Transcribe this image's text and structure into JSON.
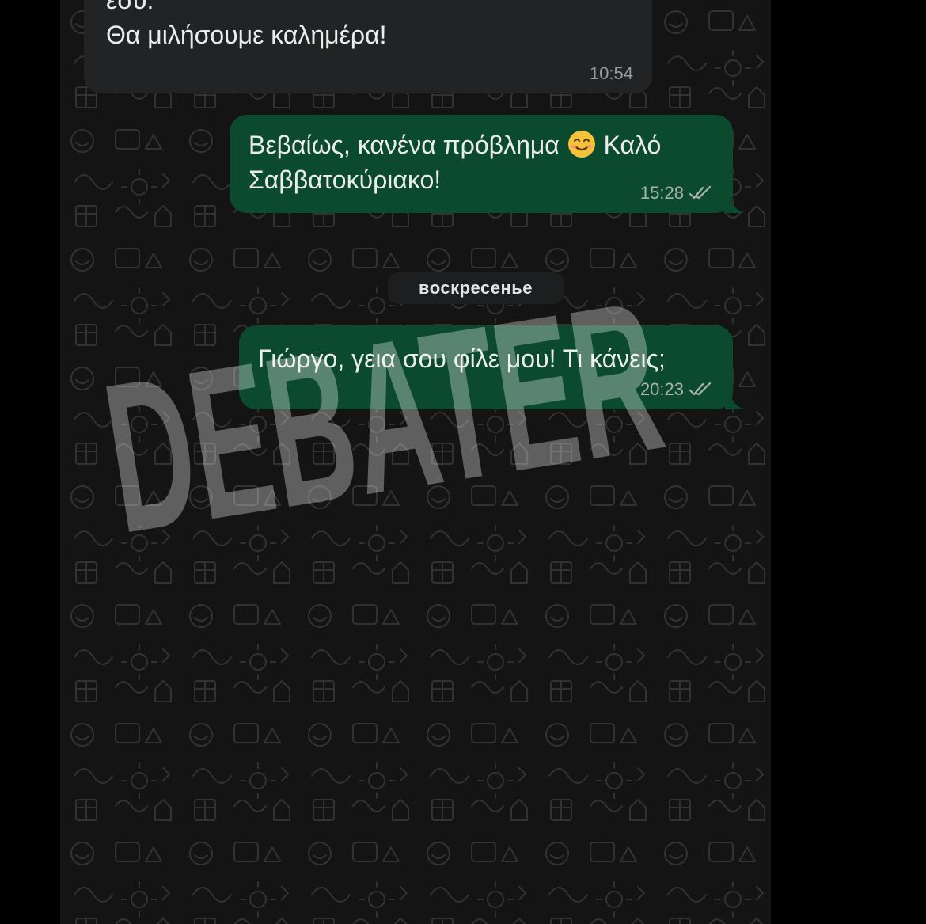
{
  "messages": [
    {
      "direction": "incoming",
      "lines": [
        "εσύ.",
        "Θα μιλήσουμε καλημέρα!"
      ],
      "time": "10:54"
    },
    {
      "direction": "outgoing",
      "line1_before_emoji": "Βεβαίως, κανένα πρόβλημα ",
      "line1_after_emoji": " Καλό",
      "line2": "Σαββατοκύριακο!",
      "emoji": "smiling-face-emoji",
      "time": "15:28",
      "status": "read"
    },
    {
      "direction": "outgoing",
      "lines": [
        "Γιώργο, γεια σου φίλε μου! Τι κάνεις;"
      ],
      "time": "20:23",
      "status": "read"
    }
  ],
  "date_separator": "воскресенье",
  "watermark": "DEBATER",
  "icons": {
    "read_receipt": "double-check-icon",
    "background": "doodle-pattern"
  },
  "colors": {
    "outgoing_bubble": "#0c4a30",
    "incoming_bubble": "#222324",
    "chat_background": "#141414",
    "page_background": "#000000"
  }
}
